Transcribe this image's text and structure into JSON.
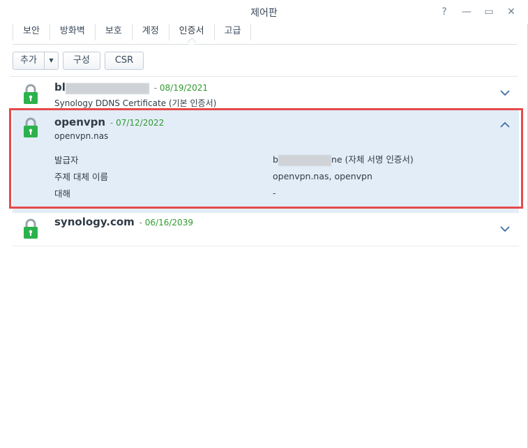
{
  "window": {
    "title": "제어판",
    "controls": {
      "help": "?",
      "minimize": "—",
      "maximize": "▭",
      "close": "✕"
    }
  },
  "tabs": [
    {
      "label": "보안"
    },
    {
      "label": "방화벽"
    },
    {
      "label": "보호"
    },
    {
      "label": "계정"
    },
    {
      "label": "인증서",
      "active": true
    },
    {
      "label": "고급"
    }
  ],
  "toolbar": {
    "add_label": "추가",
    "configure_label": "구성",
    "csr_label": "CSR"
  },
  "certificates": [
    {
      "name_visible": "bl",
      "date": "08/19/2021",
      "subtitle": "Synology DDNS Certificate (기본 인증서)",
      "expanded": false
    },
    {
      "name": "openvpn",
      "date": "07/12/2022",
      "subtitle": "openvpn.nas",
      "expanded": true,
      "details": {
        "issuer_label": "발급자",
        "issuer_prefix": "b",
        "issuer_suffix": "ne (자체 서명 인증서)",
        "san_label": "주제 대체 이름",
        "san_value": "openvpn.nas, openvpn",
        "for_label": "대해",
        "for_value": "-"
      }
    },
    {
      "name": "synology.com",
      "date": "06/16/2039",
      "subtitle": "",
      "expanded": false
    }
  ],
  "colors": {
    "accent": "#3a6fa6",
    "date_green": "#2e9a2e",
    "lock_green": "#2bb24c",
    "selected_bg": "#e3edf8",
    "highlight_red": "#e64a4a"
  },
  "icons": {
    "lock": "lock-icon",
    "expand": "chevron-down-icon",
    "collapse": "chevron-up-icon"
  }
}
